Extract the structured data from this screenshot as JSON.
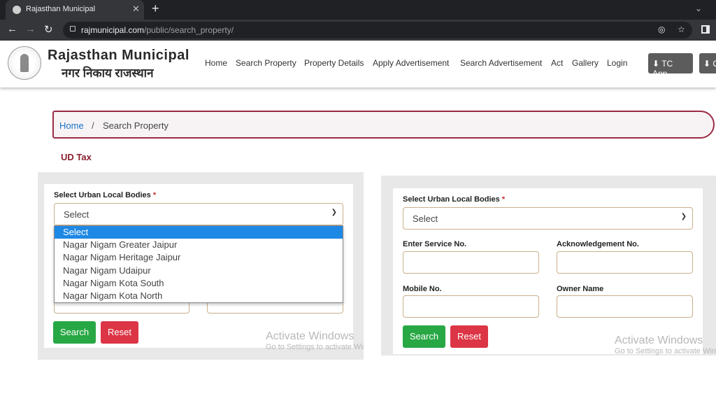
{
  "browser": {
    "tab_title": "Rajasthan Municipal",
    "url_domain": "rajmunicipal.com",
    "url_path": "/public/search_property/"
  },
  "site": {
    "brand_en": "Rajasthan Municipal",
    "brand_hi": "नगर निकाय राजस्थान",
    "nav": [
      "Home",
      "Search Property",
      "Property Details",
      "Apply Advertisement",
      "Search Advertisement",
      "Act",
      "Gallery",
      "Login"
    ],
    "tc_app_label": "TC App",
    "second_btn_label": "C"
  },
  "breadcrumb": {
    "home": "Home",
    "separator": "/",
    "current": "Search Property"
  },
  "section_title": "UD Tax",
  "left_form": {
    "ulb_label": "Select Urban Local Bodies",
    "required_mark": "*",
    "select_value": "Select",
    "dropdown_options": [
      "Select",
      "Nagar Nigam Greater Jaipur",
      "Nagar Nigam Heritage Jaipur",
      "Nagar Nigam Udaipur",
      "Nagar Nigam Kota South",
      "Nagar Nigam Kota North"
    ],
    "search_label": "Search",
    "reset_label": "Reset"
  },
  "right_form": {
    "ulb_label": "Select Urban Local Bodies",
    "required_mark": "*",
    "select_value": "Select",
    "service_no_label": "Enter Service No.",
    "ack_no_label": "Acknowledgement No.",
    "mobile_label": "Mobile No.",
    "owner_label": "Owner Name",
    "search_label": "Search",
    "reset_label": "Reset"
  },
  "watermark": {
    "line1": "Activate Windows",
    "line2": "Go to Settings to activate Windows."
  },
  "colors": {
    "accent": "#9a2a44",
    "success": "#28a745",
    "danger": "#dc3545",
    "link": "#1a73c8"
  }
}
